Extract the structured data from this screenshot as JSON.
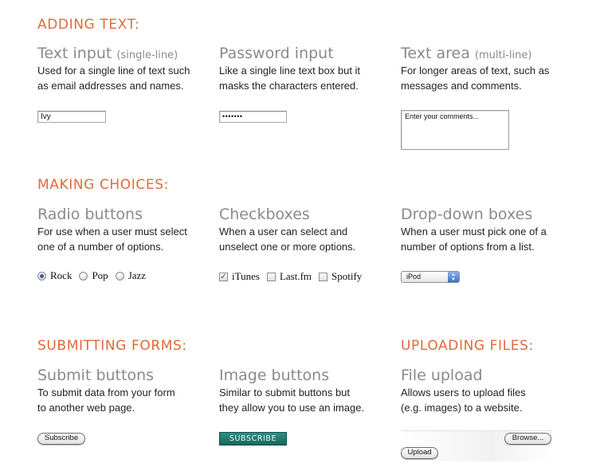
{
  "sections": {
    "adding_text": "ADDING TEXT:",
    "making_choices": "MAKING CHOICES:",
    "submitting_forms": "SUBMITTING FORMS:",
    "uploading_files": "UPLOADING FILES:"
  },
  "text_input": {
    "title": "Text input",
    "note": "(single-line)",
    "desc_line1": "Used for a single line of text such",
    "desc_line2": "as email addresses and names.",
    "value": "Ivy"
  },
  "password_input": {
    "title": "Password input",
    "desc_line1": "Like a single line text box but it",
    "desc_line2": "masks the characters entered.",
    "value": "•••••••"
  },
  "text_area": {
    "title": "Text area",
    "note": "(multi-line)",
    "desc_line1": "For longer areas of text, such as",
    "desc_line2": "messages and comments.",
    "value": "Enter your comments..."
  },
  "radio_buttons": {
    "title": "Radio buttons",
    "desc_line1": "For use when a user must select",
    "desc_line2": "one of a number of options.",
    "options": [
      "Rock",
      "Pop",
      "Jazz"
    ],
    "selected": "Rock"
  },
  "checkboxes": {
    "title": "Checkboxes",
    "desc_line1": "When a user can select and",
    "desc_line2": "unselect one or more options.",
    "options": [
      "iTunes",
      "Last.fm",
      "Spotify"
    ],
    "checked": [
      "iTunes"
    ]
  },
  "dropdown": {
    "title": "Drop-down boxes",
    "desc_line1": "When a user must pick one of a",
    "desc_line2": "number of options from a list.",
    "selected_value": "iPod"
  },
  "submit_buttons": {
    "title": "Submit buttons",
    "desc_line1": "To submit data from your form",
    "desc_line2": "to another web page.",
    "button_label": "Subscribe"
  },
  "image_buttons": {
    "title": "Image buttons",
    "desc_line1": "Similar to submit buttons but",
    "desc_line2": "they allow you to use an image.",
    "button_label": "SUBSCRIBE",
    "button_color": "#1f7a70"
  },
  "file_upload": {
    "title": "File upload",
    "desc_line1": "Allows users to upload files",
    "desc_line2": "(e.g. images) to a website.",
    "browse_label": "Browse...",
    "upload_label": "Upload"
  },
  "colors": {
    "heading": "#e0683c",
    "subheading": "#8a8a8a",
    "body_text": "#231f20"
  }
}
